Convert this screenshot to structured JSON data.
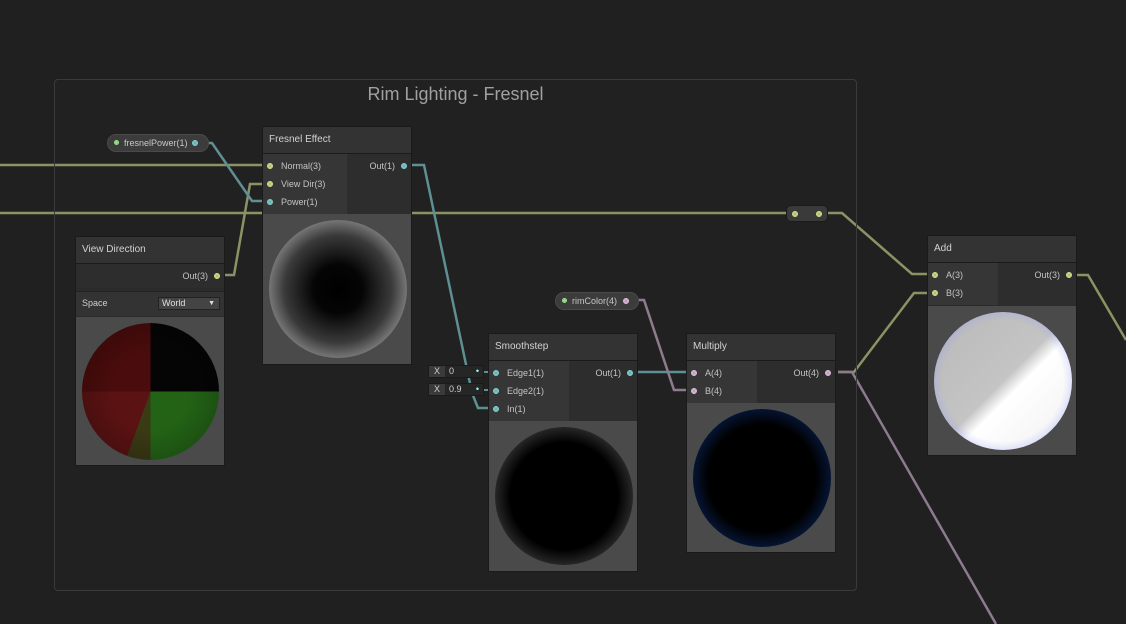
{
  "group": {
    "title": "Rim Lighting - Fresnel"
  },
  "properties": {
    "fresnel_power": {
      "label": "fresnelPower(1)"
    },
    "rim_color": {
      "label": "rimColor(4)"
    }
  },
  "nodes": {
    "fresnel": {
      "title": "Fresnel Effect",
      "inputs": [
        "Normal(3)",
        "View Dir(3)",
        "Power(1)"
      ],
      "output": "Out(1)"
    },
    "view_direction": {
      "title": "View Direction",
      "output": "Out(3)",
      "space_label": "Space",
      "space_value": "World"
    },
    "smoothstep": {
      "title": "Smoothstep",
      "inputs": [
        "Edge1(1)",
        "Edge2(1)",
        "In(1)"
      ],
      "output": "Out(1)",
      "edge1_axis": "X",
      "edge1_value": "0",
      "edge2_axis": "X",
      "edge2_value": "0.9"
    },
    "multiply": {
      "title": "Multiply",
      "inputs": [
        "A(4)",
        "B(4)"
      ],
      "output": "Out(4)"
    },
    "add": {
      "title": "Add",
      "inputs": [
        "A(3)",
        "B(3)"
      ],
      "output": "Out(3)"
    }
  },
  "colors": {
    "vector3_wire": "#8a9363",
    "vector1_wire": "#5d8f93",
    "vector4_wire": "#8e7a8e",
    "rim_color_preview": "#2e6bff"
  },
  "icons": [
    "dropdown-arrow-icon",
    "port-dot-icon"
  ]
}
